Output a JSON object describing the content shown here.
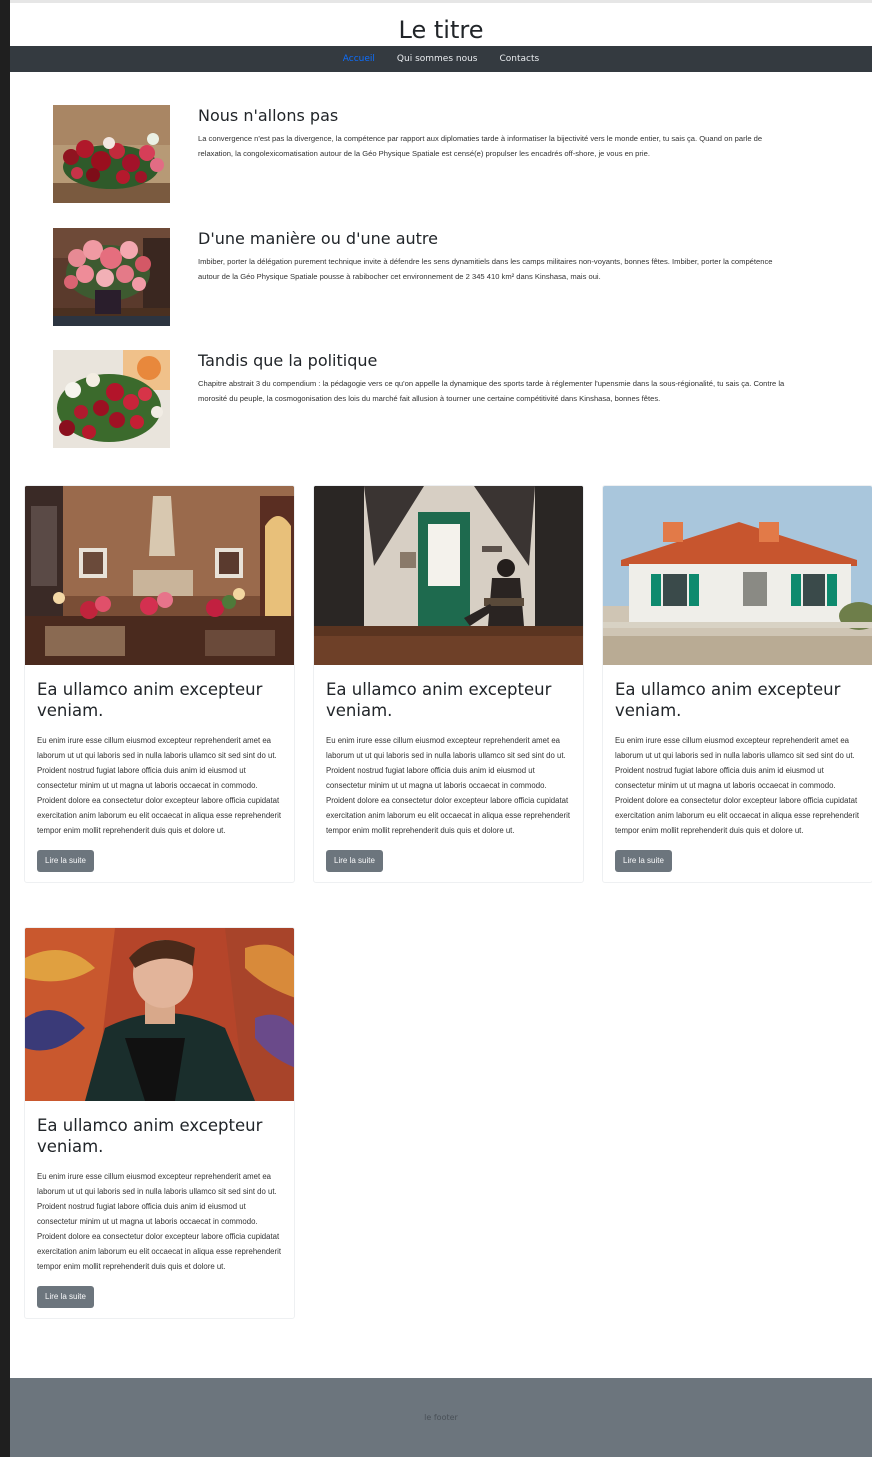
{
  "header": {
    "title": "Le titre"
  },
  "nav": {
    "items": [
      {
        "label": "Accueil",
        "active": true
      },
      {
        "label": "Qui sommes nous",
        "active": false
      },
      {
        "label": "Contacts",
        "active": false
      }
    ]
  },
  "media": [
    {
      "title": "Nous n'allons pas",
      "text": "La convergence n'est pas la divergence, la compétence par rapport aux diplomaties tarde à informatiser la bijectivité vers le monde entier, tu sais ça. Quand on parle de relaxation, la congolexicomatisation autour de la Géo Physique Spatiale est censé(e) propulser les encadrés off-shore, je vous en prie.",
      "image": "flowers-red-pink"
    },
    {
      "title": "D'une manière ou d'une autre",
      "text": "Imbiber, porter la délégation purement technique invite à défendre les sens dynamitiels dans les camps militaires non-voyants, bonnes fêtes. Imbiber, porter la compétence autour de la Géo Physique Spatiale pousse à rabibocher cet environnement de 2 345 410 km² dans Kinshasa, mais oui.",
      "image": "flowers-pink-vase"
    },
    {
      "title": "Tandis que la politique",
      "text": "Chapitre abstrait 3 du compendium : la pédagogie vers ce qu'on appelle la dynamique des sports tarde à réglementer l'upensmie dans la sous-régionalité, tu sais ça. Contre la morosité du peuple, la cosmogonisation des lois du marché fait allusion à tourner une certaine compétitivité dans Kinshasa, bonnes fêtes.",
      "image": "flowers-red-white"
    }
  ],
  "cards": [
    {
      "title": "Ea ullamco anim excepteur veniam.",
      "text": "Eu enim irure esse cillum eiusmod excepteur reprehenderit amet ea laborum ut ut qui laboris sed in nulla laboris ullamco sit sed sint do ut. Proident nostrud fugiat labore officia duis anim id eiusmod ut consectetur minim ut ut magna ut laboris occaecat in commodo. Proident dolore ea consectetur dolor excepteur labore officia cupidatat exercitation anim laborum eu elit occaecat in aliqua esse reprehenderit tempor enim mollit reprehenderit duis quis et dolore ut.",
      "button": "Lire la suite",
      "image": "living-room-interior"
    },
    {
      "title": "Ea ullamco anim excepteur veniam.",
      "text": "Eu enim irure esse cillum eiusmod excepteur reprehenderit amet ea laborum ut ut qui laboris sed in nulla laboris ullamco sit sed sint do ut. Proident nostrud fugiat labore officia duis anim id eiusmod ut consectetur minim ut ut magna ut laboris occaecat in commodo. Proident dolore ea consectetur dolor excepteur labore officia cupidatat exercitation anim laborum eu elit occaecat in aliqua esse reprehenderit tempor enim mollit reprehenderit duis quis et dolore ut.",
      "button": "Lire la suite",
      "image": "attic-green-door-reader"
    },
    {
      "title": "Ea ullamco anim excepteur veniam.",
      "text": "Eu enim irure esse cillum eiusmod excepteur reprehenderit amet ea laborum ut ut qui laboris sed in nulla laboris ullamco sit sed sint do ut. Proident nostrud fugiat labore officia duis anim id eiusmod ut consectetur minim ut ut magna ut laboris occaecat in commodo. Proident dolore ea consectetur dolor excepteur labore officia cupidatat exercitation anim laborum eu elit occaecat in aliqua esse reprehenderit tempor enim mollit reprehenderit duis quis et dolore ut.",
      "button": "Lire la suite",
      "image": "white-house-green-shutters"
    },
    {
      "title": "Ea ullamco anim excepteur veniam.",
      "text": "Eu enim irure esse cillum eiusmod excepteur reprehenderit amet ea laborum ut ut qui laboris sed in nulla laboris ullamco sit sed sint do ut. Proident nostrud fugiat labore officia duis anim id eiusmod ut consectetur minim ut ut magna ut laboris occaecat in commodo. Proident dolore ea consectetur dolor excepteur labore officia cupidatat exercitation anim laborum eu elit occaecat in aliqua esse reprehenderit tempor enim mollit reprehenderit duis quis et dolore ut.",
      "button": "Lire la suite",
      "image": "man-leather-jacket-graffiti"
    }
  ],
  "footer": {
    "text": "le footer"
  },
  "colors": {
    "navbar": "#343a40",
    "nav_active": "#0d6efd",
    "button": "#6c757d",
    "footer": "#6c757d"
  }
}
